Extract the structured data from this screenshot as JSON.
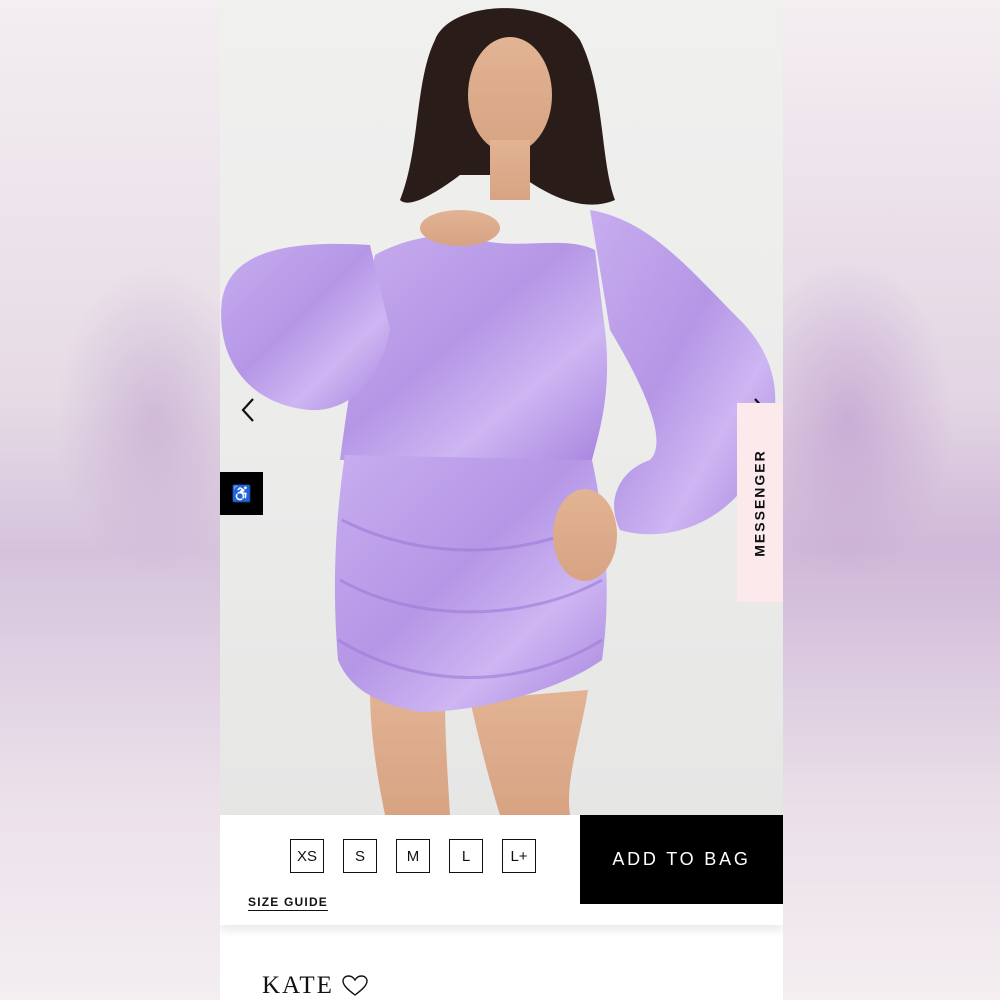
{
  "photo": {
    "alt_icon": "product-photo"
  },
  "carousel": {
    "prev_icon": "chevron-left-icon",
    "next_icon": "chevron-right-icon"
  },
  "accessibility": {
    "icon": "wheelchair-icon",
    "glyph": "♿"
  },
  "messenger": {
    "label": "MESSENGER"
  },
  "sizes": [
    "XS",
    "S",
    "M",
    "L",
    "L+"
  ],
  "size_guide": "SIZE GUIDE",
  "add_to_bag": "ADD TO BAG",
  "product": {
    "name": "KATE",
    "wishlist_icon": "heart-outline-icon"
  },
  "colors": {
    "accent_black": "#000000",
    "messenger_bg": "#fbe9ec",
    "dress": "#b99be6"
  }
}
